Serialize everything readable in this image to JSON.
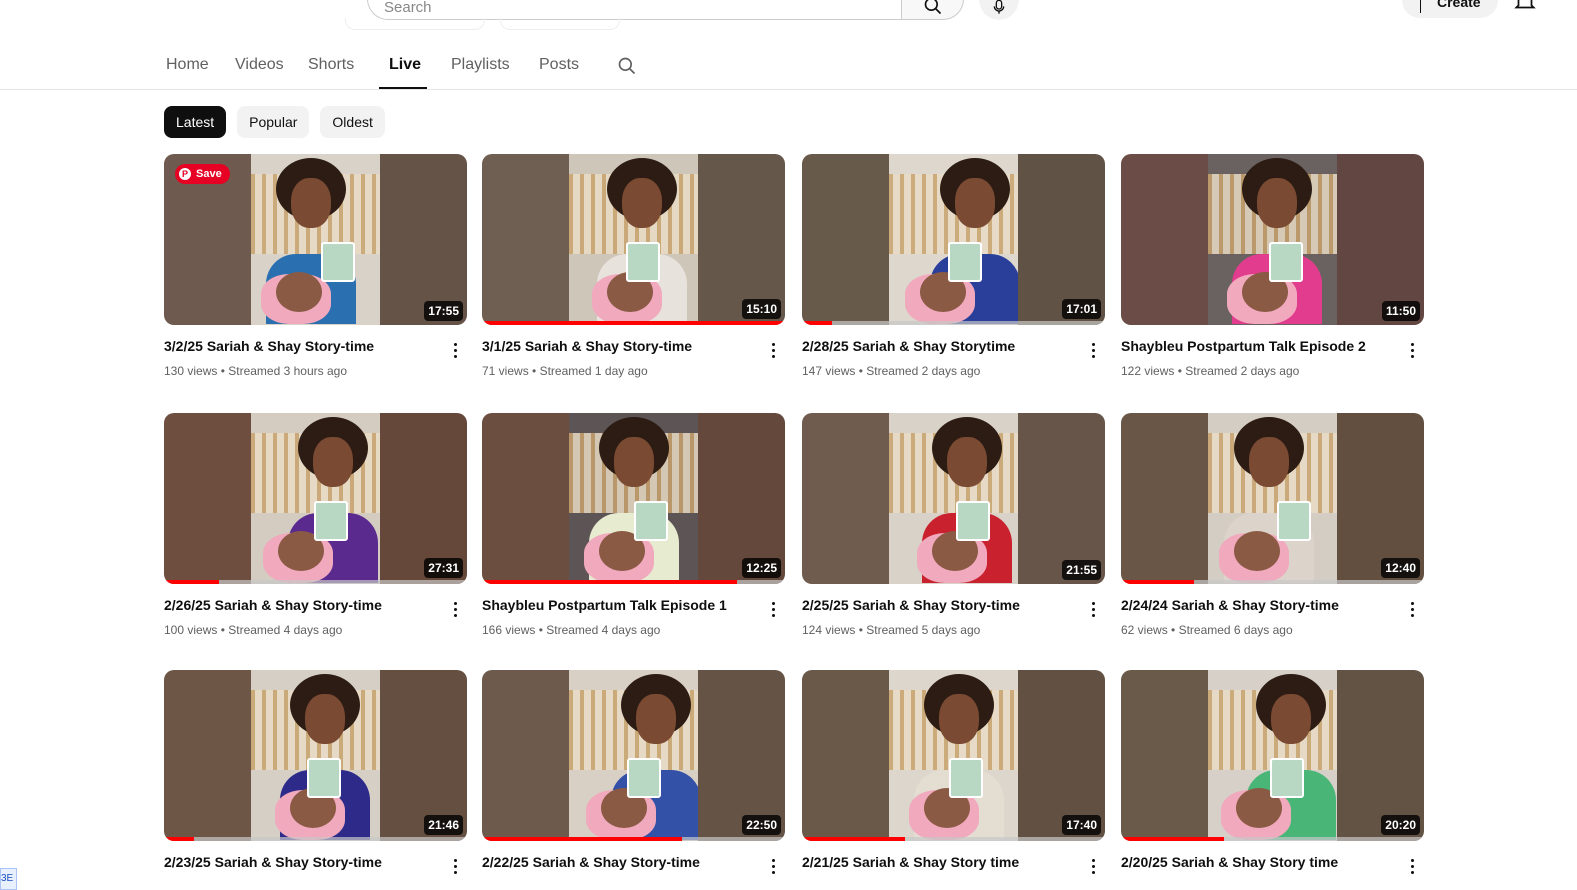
{
  "header": {
    "search_placeholder": "Search",
    "create_label": "Create"
  },
  "tabs": [
    {
      "label": "Home"
    },
    {
      "label": "Videos"
    },
    {
      "label": "Shorts"
    },
    {
      "label": "Live",
      "active": true
    },
    {
      "label": "Playlists"
    },
    {
      "label": "Posts"
    }
  ],
  "chips": [
    {
      "label": "Latest",
      "active": true
    },
    {
      "label": "Popular"
    },
    {
      "label": "Oldest"
    }
  ],
  "save_badge": "Save",
  "corner_tag": "3E",
  "videos": [
    {
      "title": "3/2/25 Sariah & Shay Story-time",
      "views": "130 views",
      "streamed": "Streamed 3 hours ago",
      "duration": "17:55",
      "progress": 0,
      "shirt": "#2a6fb0",
      "wall": "#d8d2c8",
      "bg": "#6e5a4e"
    },
    {
      "title": "3/1/25 Sariah & Shay Story-time",
      "views": "71 views",
      "streamed": "Streamed 1 day ago",
      "duration": "15:10",
      "progress": 1.0,
      "shirt": "#e8e2dc",
      "wall": "#cfc6ba",
      "bg": "#6f5f52"
    },
    {
      "title": "2/28/25 Sariah & Shay Storytime",
      "views": "147 views",
      "streamed": "Streamed 2 days ago",
      "duration": "17:01",
      "progress": 0.1,
      "shirt": "#2a3f9a",
      "wall": "#ddd7cd",
      "bg": "#685a4b"
    },
    {
      "title": "Shaybleu Postpartum Talk Episode 2",
      "views": "122 views",
      "streamed": "Streamed 2 days ago",
      "duration": "11:50",
      "progress": 0,
      "shirt": "#e13c8d",
      "wall": "#6a6260",
      "bg": "#6b4c47"
    },
    {
      "title": "2/26/25 Sariah & Shay Story-time",
      "views": "100 views",
      "streamed": "Streamed 4 days ago",
      "duration": "27:31",
      "progress": 0.18,
      "shirt": "#5a2a8e",
      "wall": "#d4ccc0",
      "bg": "#6e4e3e"
    },
    {
      "title": "Shaybleu Postpartum Talk Episode 1",
      "views": "166 views",
      "streamed": "Streamed 4 days ago",
      "duration": "12:25",
      "progress": 0.84,
      "shirt": "#e7ecd0",
      "wall": "#5d5555",
      "bg": "#6c4e40"
    },
    {
      "title": "2/25/25 Sariah & Shay Story-time",
      "views": "124 views",
      "streamed": "Streamed 5 days ago",
      "duration": "21:55",
      "progress": 0,
      "shirt": "#c9222e",
      "wall": "#d8d2c8",
      "bg": "#6f5c4e"
    },
    {
      "title": "2/24/24 Sariah & Shay Story-time",
      "views": "62 views",
      "streamed": "Streamed 6 days ago",
      "duration": "12:40",
      "progress": 0.24,
      "shirt": "#dcd4cb",
      "wall": "#d4cdc3",
      "bg": "#6a5646"
    },
    {
      "title": "2/23/25 Sariah & Shay Story-time",
      "views": "",
      "streamed": "",
      "duration": "21:46",
      "progress": 0.1,
      "shirt": "#2e2a8a",
      "wall": "#d6cfc5",
      "bg": "#6d5646"
    },
    {
      "title": "2/22/25 Sariah & Shay Story-time",
      "views": "",
      "streamed": "",
      "duration": "22:50",
      "progress": 0.66,
      "shirt": "#3451a8",
      "wall": "#d8d0c4",
      "bg": "#6e5a4c"
    },
    {
      "title": "2/21/25 Sariah & Shay Story time",
      "views": "",
      "streamed": "",
      "duration": "17:40",
      "progress": 0.34,
      "shirt": "#e4ddd2",
      "wall": "#dcd6cc",
      "bg": "#6a5848"
    },
    {
      "title": "2/20/25 Sariah & Shay Story time",
      "views": "",
      "streamed": "",
      "duration": "20:20",
      "progress": 0.34,
      "shirt": "#49b678",
      "wall": "#d6d0c8",
      "bg": "#6a5a4a"
    }
  ]
}
